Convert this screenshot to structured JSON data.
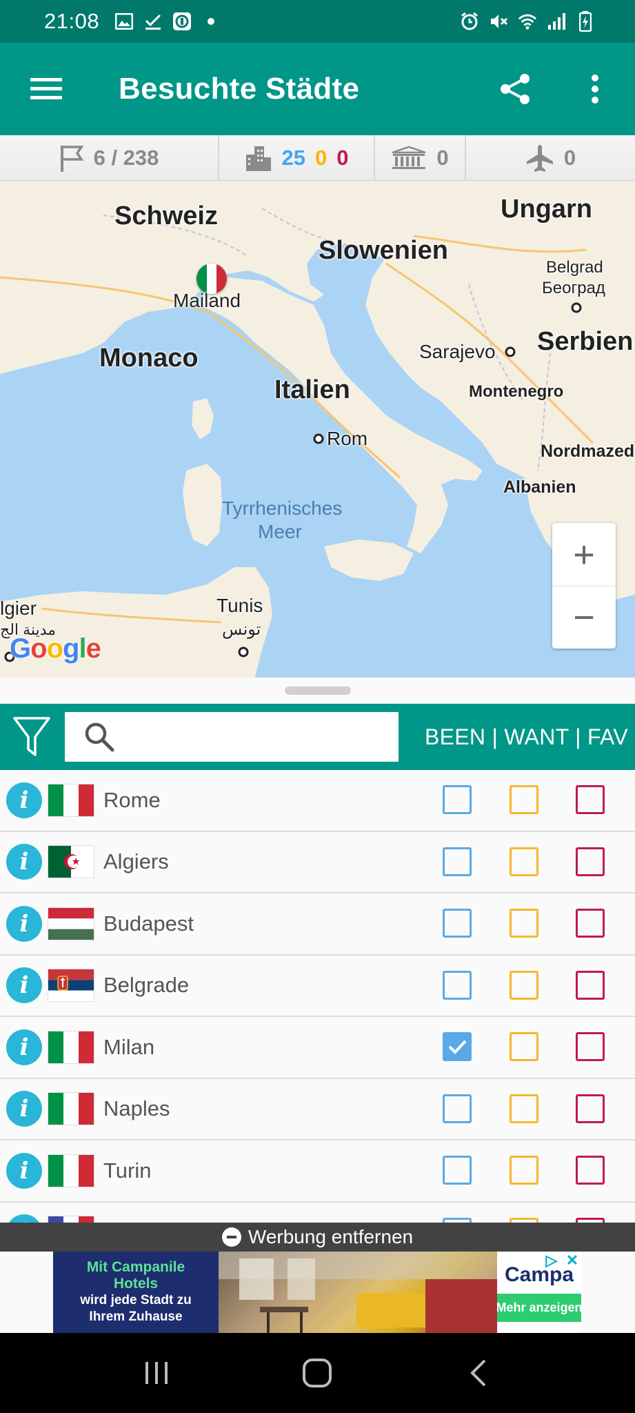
{
  "status_bar": {
    "time": "21:08",
    "left_icons": [
      "gallery-icon",
      "download-check-icon",
      "vpn-icon",
      "dot-icon"
    ],
    "right_icons": [
      "alarm-icon",
      "mute-icon",
      "wifi-icon",
      "signal-icon",
      "battery-icon"
    ]
  },
  "app_bar": {
    "title": "Besuchte Städte",
    "icons": [
      "menu-icon",
      "share-icon",
      "more-vert-icon"
    ]
  },
  "stats": {
    "countries": "6 / 238",
    "cities_been": "25",
    "cities_want": "0",
    "cities_fav": "0",
    "unesco": "0",
    "airports": "0"
  },
  "map": {
    "labels": {
      "schweiz": "Schweiz",
      "ungarn": "Ungarn",
      "slowenien": "Slowenien",
      "belgrad": "Belgrad",
      "beograd": "Београд",
      "mailand": "Mailand",
      "monaco": "Monaco",
      "sarajevo": "Sarajevo",
      "serbien": "Serbien",
      "italien": "Italien",
      "montenegro": "Montenegro",
      "rom": "Rom",
      "nordmazedonien": "Nordmazed",
      "albanien": "Albanien",
      "tyrrhenisches": "Tyrrhenisches",
      "meer": "Meer",
      "tunis": "Tunis",
      "tunis_ar": "تونس",
      "algier": "lgier",
      "algier_ar": "مدينة الج"
    },
    "zoom_in": "+",
    "zoom_out": "−",
    "attribution": "Google"
  },
  "filter_bar": {
    "search_placeholder": "",
    "columns_header": "BEEN | WANT | FAV"
  },
  "cities": [
    {
      "name": "Rome",
      "flag": "it",
      "been": false,
      "want": false,
      "fav": false
    },
    {
      "name": "Algiers",
      "flag": "dz",
      "been": false,
      "want": false,
      "fav": false
    },
    {
      "name": "Budapest",
      "flag": "hu",
      "been": false,
      "want": false,
      "fav": false
    },
    {
      "name": "Belgrade",
      "flag": "rs",
      "been": false,
      "want": false,
      "fav": false
    },
    {
      "name": "Milan",
      "flag": "it",
      "been": true,
      "want": false,
      "fav": false
    },
    {
      "name": "Naples",
      "flag": "it",
      "been": false,
      "want": false,
      "fav": false
    },
    {
      "name": "Turin",
      "flag": "it",
      "been": false,
      "want": false,
      "fav": false
    },
    {
      "name": "",
      "flag": "fr",
      "been": false,
      "want": false,
      "fav": false
    }
  ],
  "info_glyph": "i",
  "ad": {
    "remove_label": "Werbung entfernen",
    "headline_line1": "Mit Campanile",
    "headline_line2": "Hotels",
    "sub_line1": "wird jede Stadt zu",
    "sub_line2": "Ihrem Zuhause",
    "brand": "Campa",
    "cta": "Mehr anzeigen"
  },
  "nav_bar": {
    "icons": [
      "recents-icon",
      "home-icon",
      "back-icon"
    ]
  },
  "colors": {
    "status_bar": "#00796b",
    "primary": "#009688",
    "been": "#5aa9e6",
    "want": "#f5b82a",
    "fav": "#c2185b",
    "info": "#29b6d8"
  }
}
